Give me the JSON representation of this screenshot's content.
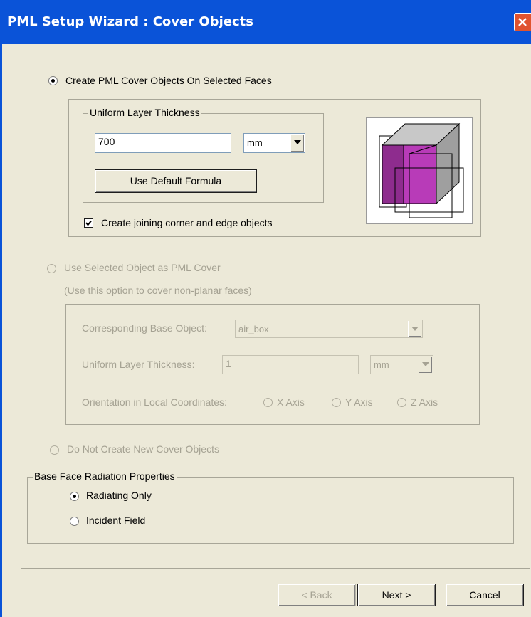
{
  "window": {
    "title": "PML Setup Wizard : Cover Objects"
  },
  "option_create": {
    "label": "Create PML Cover Objects On Selected Faces",
    "thickness_group_label": "Uniform Layer Thickness",
    "thickness_value": "700",
    "unit": "mm",
    "default_formula_button": "Use Default Formula",
    "joining_checkbox_label": "Create joining corner and edge objects"
  },
  "option_selected": {
    "label": "Use Selected Object as PML Cover",
    "hint": "(Use this option to cover non-planar faces)",
    "base_object_label": "Corresponding Base Object:",
    "base_object_value": "air_box",
    "thickness_label": "Uniform Layer Thickness:",
    "thickness_value": "1",
    "unit": "mm",
    "orientation_label": "Orientation in Local Coordinates:",
    "axes": [
      "X Axis",
      "Y Axis",
      "Z Axis"
    ]
  },
  "option_none": {
    "label": "Do Not Create New Cover Objects"
  },
  "radiation": {
    "group_label": "Base Face Radiation Properties",
    "options": [
      "Radiating Only",
      "Incident Field"
    ]
  },
  "buttons": {
    "back": "< Back",
    "next": "Next >",
    "cancel": "Cancel"
  },
  "colors": {
    "titlebar": "#0a53d8",
    "dialog": "#ece9d8",
    "cube_face": "#b83bb8",
    "cube_top": "#c8c8c8"
  }
}
